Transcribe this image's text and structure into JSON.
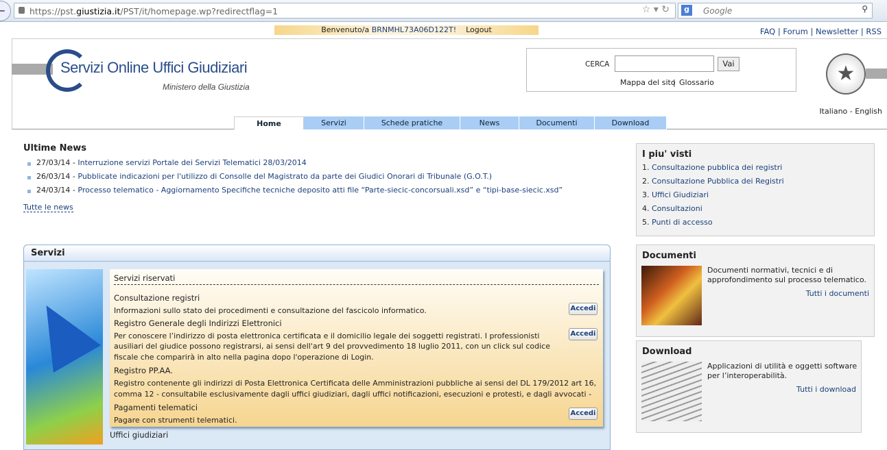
{
  "browser": {
    "url_prefix": "https://pst.",
    "url_domain": "giustizia.it",
    "url_path": "/PST/it/homepage.wp?redirectflag=1",
    "search_placeholder": "Google"
  },
  "welcome": {
    "label": "Benvenuto/a",
    "user": "BRNMHL73A06D122T!",
    "logout": "Logout"
  },
  "toplinks": [
    "FAQ",
    "Forum",
    "Newsletter",
    "RSS"
  ],
  "logo": {
    "title": "Servizi Online Uffici Giudiziari",
    "subtitle": "Ministero della Giustizia"
  },
  "search": {
    "label": "CERCA",
    "button": "Vai",
    "links": [
      "Mappa del sito",
      "Glossario"
    ]
  },
  "lang": {
    "it": "Italiano",
    "en": "English"
  },
  "nav": [
    "Home",
    "Servizi",
    "Schede pratiche",
    "News",
    "Documenti",
    "Download"
  ],
  "news": {
    "title": "Ultime News",
    "items": [
      {
        "date": "27/03/14 -",
        "text": "Interruzione servizi Portale dei Servizi Telematici 28/03/2014"
      },
      {
        "date": "26/03/14 -",
        "text": "Pubblicate indicazioni per l'utilizzo di Consolle del Magistrato da parte dei Giudici Onorari di Tribunale (G.O.T.)"
      },
      {
        "date": "24/03/14 -",
        "text": "Processo telematico - Aggiornamento Specifiche tecniche deposito atti file “Parte-siecic-concorsuali.xsd” e “tipi-base-siecic.xsd”"
      }
    ],
    "all": "Tutte le news"
  },
  "servizi": {
    "title": "Servizi",
    "riservati": "Servizi riservati",
    "items": [
      {
        "title": "Consultazione registri",
        "desc": "Informazioni sullo stato dei procedimenti e consultazione del fascicolo informatico.",
        "button": "Accedi"
      },
      {
        "title": "Registro Generale degli Indirizzi Elettronici",
        "desc": "Per conoscere l’indirizzo di posta elettronica certificata e il domicilio legale dei soggetti registrati. I professionisti ausiliari del giudice possono registrarsi, ai sensi dell'art 9 del provvedimento 18 luglio 2011, con un click sul codice fiscale che comparirà in alto nella pagina dopo l'operazione di Login.",
        "button": "Accedi"
      },
      {
        "title": "Registro PP.AA.",
        "desc": "Registro contenente gli indirizzi di Posta Elettronica Certificata delle Amministrazioni pubbliche ai sensi del DL 179/2012 art 16, comma 12 - consultabile esclusivamente dagli uffici giudiziari, dagli uffici notificazioni, esecuzioni e protesti, e dagli avvocati -"
      },
      {
        "title": "Pagamenti telematici",
        "desc": "Pagare con strumenti telematici.",
        "button": "Accedi"
      }
    ],
    "uffici": "Uffici giudiziari"
  },
  "piu_visti": {
    "title": "I piu' visti",
    "items": [
      "Consultazione pubblica dei registri",
      "Consultazione Pubblica dei Registri",
      "Uffici Giudiziari",
      "Consultazioni",
      "Punti di accesso"
    ]
  },
  "documenti": {
    "title": "Documenti",
    "desc": "Documenti normativi, tecnici e di approfondimento sul processo telematico.",
    "link": "Tutti i documenti"
  },
  "download": {
    "title": "Download",
    "desc": "Applicazioni di utilità e oggetti software per l’interoperabilità.",
    "link": "Tutti i download"
  }
}
